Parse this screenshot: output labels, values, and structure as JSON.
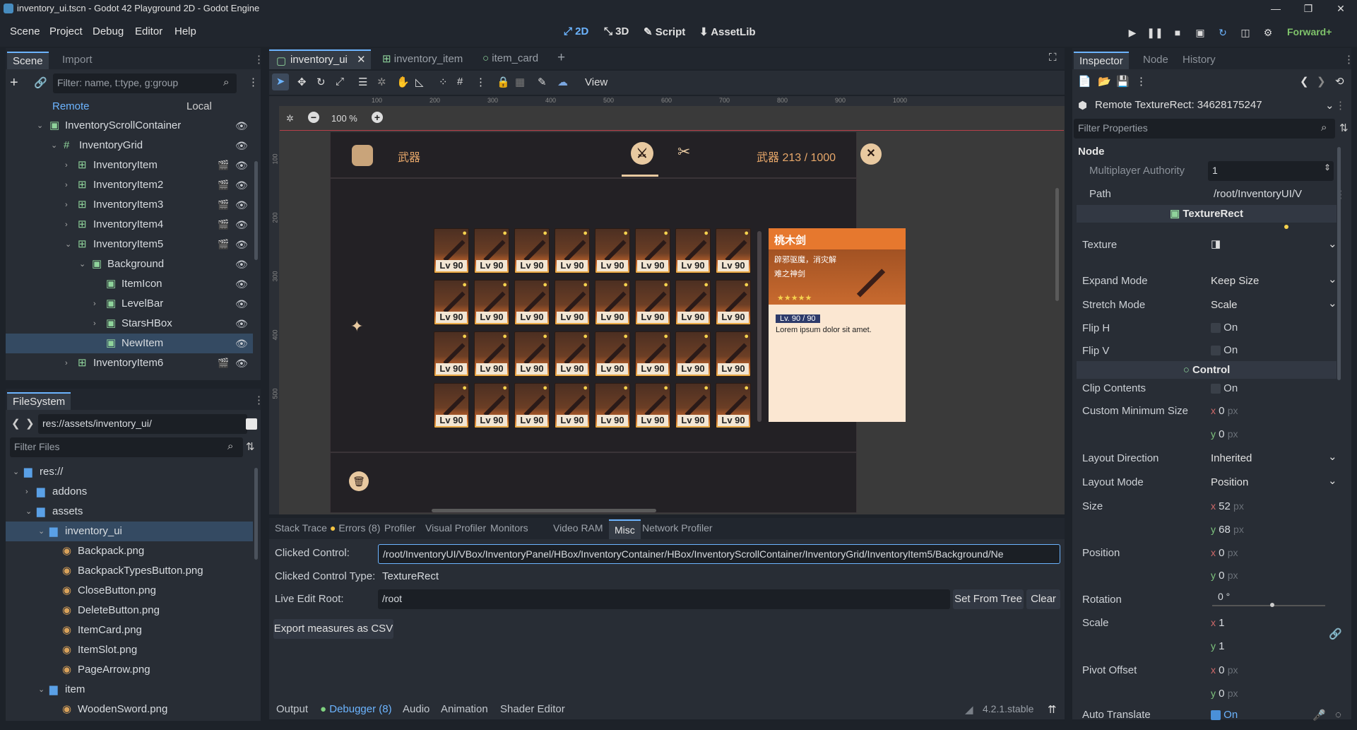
{
  "window": {
    "title": "inventory_ui.tscn - Godot 42 Playground 2D - Godot Engine"
  },
  "menu": [
    "Scene",
    "Project",
    "Debug",
    "Editor",
    "Help"
  ],
  "modes": [
    "2D",
    "3D",
    "Script",
    "AssetLib"
  ],
  "renderer": "Forward+",
  "scene_dock": {
    "tabs": [
      "Scene",
      "Import"
    ],
    "filter_placeholder": "Filter: name, t:type, g:group",
    "remote": "Remote",
    "local": "Local",
    "tree": [
      {
        "label": "InventoryScrollContainer",
        "indent": 0
      },
      {
        "label": "InventoryGrid",
        "indent": 1
      },
      {
        "label": "InventoryItem",
        "indent": 2
      },
      {
        "label": "InventoryItem2",
        "indent": 2
      },
      {
        "label": "InventoryItem3",
        "indent": 2
      },
      {
        "label": "InventoryItem4",
        "indent": 2
      },
      {
        "label": "InventoryItem5",
        "indent": 2
      },
      {
        "label": "Background",
        "indent": 3
      },
      {
        "label": "ItemIcon",
        "indent": 4
      },
      {
        "label": "LevelBar",
        "indent": 4
      },
      {
        "label": "StarsHBox",
        "indent": 4
      },
      {
        "label": "NewItem",
        "indent": 4
      },
      {
        "label": "InventoryItem6",
        "indent": 2
      }
    ]
  },
  "filesystem": {
    "tab": "FileSystem",
    "path": "res://assets/inventory_ui/",
    "filter_placeholder": "Filter Files",
    "items": [
      {
        "label": "res://",
        "indent": 0
      },
      {
        "label": "addons",
        "indent": 1
      },
      {
        "label": "assets",
        "indent": 1
      },
      {
        "label": "inventory_ui",
        "indent": 2
      },
      {
        "label": "Backpack.png",
        "indent": 3
      },
      {
        "label": "BackpackTypesButton.png",
        "indent": 3
      },
      {
        "label": "CloseButton.png",
        "indent": 3
      },
      {
        "label": "DeleteButton.png",
        "indent": 3
      },
      {
        "label": "ItemCard.png",
        "indent": 3
      },
      {
        "label": "ItemSlot.png",
        "indent": 3
      },
      {
        "label": "PageArrow.png",
        "indent": 3
      },
      {
        "label": "item",
        "indent": 2
      },
      {
        "label": "WoodenSword.png",
        "indent": 3
      }
    ]
  },
  "editor_tabs": [
    "inventory_ui",
    "inventory_item",
    "item_card"
  ],
  "toolbar": {
    "view": "View",
    "zoom": "100 %"
  },
  "ruler": [
    "100",
    "200",
    "300",
    "400",
    "500",
    "600",
    "700",
    "800",
    "900",
    "1000"
  ],
  "vruler": [
    "100",
    "200",
    "300",
    "400",
    "500"
  ],
  "game": {
    "category": "武器",
    "counter": "武器 213 / 1000",
    "slot_label": "Lv 90",
    "card": {
      "title": "桃木剑",
      "desc1": "辟邪驱魔，消灾解",
      "desc2": "难之神剑",
      "stars": "★★★★★",
      "level": "Lv. 90 / 90",
      "text": "Lorem ipsum dolor sit amet."
    }
  },
  "debugger": {
    "tabs": [
      "Stack Trace",
      "Errors (8)",
      "Profiler",
      "Visual Profiler",
      "Monitors",
      "Video RAM",
      "Misc",
      "Network Profiler"
    ],
    "clicked_control_label": "Clicked Control:",
    "clicked_control": "/root/InventoryUI/VBox/InventoryPanel/HBox/InventoryContainer/HBox/InventoryScrollContainer/InventoryGrid/InventoryItem5/Background/Ne",
    "type_label": "Clicked Control Type:",
    "type": "TextureRect",
    "root_label": "Live Edit Root:",
    "root": "/root",
    "set_from_tree": "Set From Tree",
    "clear": "Clear",
    "export": "Export measures as CSV"
  },
  "bottom_tabs": [
    "Output",
    "Debugger (8)",
    "Audio",
    "Animation",
    "Shader Editor"
  ],
  "version": "4.2.1.stable",
  "inspector": {
    "tabs": [
      "Inspector",
      "Node",
      "History"
    ],
    "object": "Remote TextureRect: 34628175247",
    "filter": "Filter Properties",
    "node_section": "Node",
    "mp_label": "Multiplayer Authority",
    "mp_value": "1",
    "path_label": "Path",
    "path_value": "/root/InventoryUI/V",
    "tr_section": "TextureRect",
    "texture": "Texture",
    "expand_label": "Expand Mode",
    "expand": "Keep Size",
    "stretch_label": "Stretch Mode",
    "stretch": "Scale",
    "fliph": "Flip H",
    "flipv": "Flip V",
    "on": "On",
    "control": "Control",
    "clip": "Clip Contents",
    "cms": "Custom Minimum Size",
    "zero": "0",
    "px": "px",
    "layoutdir_label": "Layout Direction",
    "layoutdir": "Inherited",
    "layoutmode_label": "Layout Mode",
    "layoutmode": "Position",
    "size": "Size",
    "size_x": "52",
    "size_y": "68",
    "position": "Position",
    "rotation": "Rotation",
    "rot_val": "0 °",
    "scale": "Scale",
    "one": "1",
    "pivot": "Pivot Offset",
    "autotrans": "Auto Translate",
    "x": "x",
    "y": "y"
  },
  "colors": {
    "accent": "#6cb4ff",
    "selected": "#344a62",
    "panel": "#282d35",
    "game_bg": "#232125",
    "card_orange": "#e6782e"
  }
}
